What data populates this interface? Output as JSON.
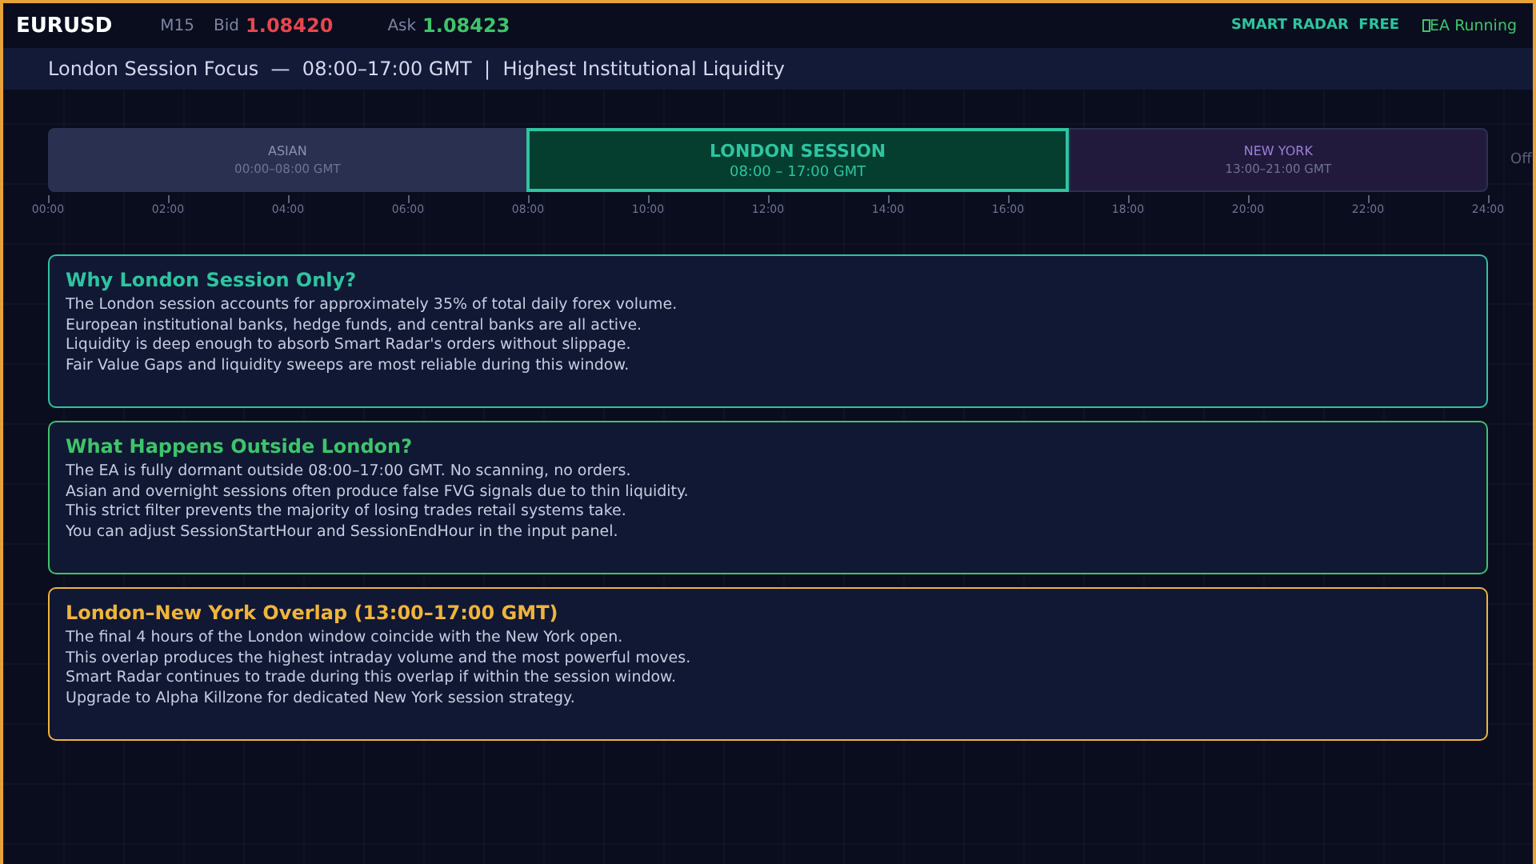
{
  "top_bar": {
    "symbol": "EURUSD",
    "timeframe": "M15",
    "bid_label": "Bid",
    "bid": "1.08420",
    "ask_label": "Ask",
    "ask": "1.08423",
    "brand": "SMART RADAR  FREE",
    "status": "EA Running"
  },
  "subheader": "London Session Focus  —  08:00–17:00 GMT  |  Highest Institutional Liquidity",
  "timeline": {
    "sessions": [
      {
        "kind": "asian",
        "name": "ASIAN",
        "hours": "00:00–08:00 GMT",
        "selected": false
      },
      {
        "kind": "london",
        "name": "LONDON SESSION",
        "hours": "08:00 – 17:00 GMT",
        "selected": true
      },
      {
        "kind": "newyork",
        "name": "NEW YORK",
        "hours": "13:00–21:00 GMT",
        "selected": false
      }
    ],
    "end_label": "Off",
    "ticks": [
      "00:00",
      "02:00",
      "04:00",
      "06:00",
      "08:00",
      "10:00",
      "12:00",
      "14:00",
      "16:00",
      "18:00",
      "20:00",
      "22:00",
      "24:00"
    ]
  },
  "cards": [
    {
      "color": "#2ec4a0",
      "title": "Why London Session Only?",
      "lines": [
        "The London session accounts for approximately 35% of total daily forex volume.",
        "European institutional banks, hedge funds, and central banks are all active.",
        "Liquidity is deep enough to absorb Smart Radar's orders without slippage.",
        "Fair Value Gaps and liquidity sweeps are most reliable during this window."
      ]
    },
    {
      "color": "#3ec46a",
      "title": "What Happens Outside London?",
      "lines": [
        "The EA is fully dormant outside 08:00–17:00 GMT. No scanning, no orders.",
        "Asian and overnight sessions often produce false FVG signals due to thin liquidity.",
        "This strict filter prevents the majority of losing trades retail systems take.",
        "You can adjust SessionStartHour and SessionEndHour in the input panel."
      ]
    },
    {
      "color": "#f0b43c",
      "title": "London–New York Overlap (13:00–17:00 GMT)",
      "lines": [
        "The final 4 hours of the London window coincide with the New York open.",
        "This overlap produces the highest intraday volume and the most powerful moves.",
        "Smart Radar continues to trade during this overlap if within the session window.",
        "Upgrade to Alpha Killzone for dedicated New York session strategy."
      ]
    }
  ]
}
